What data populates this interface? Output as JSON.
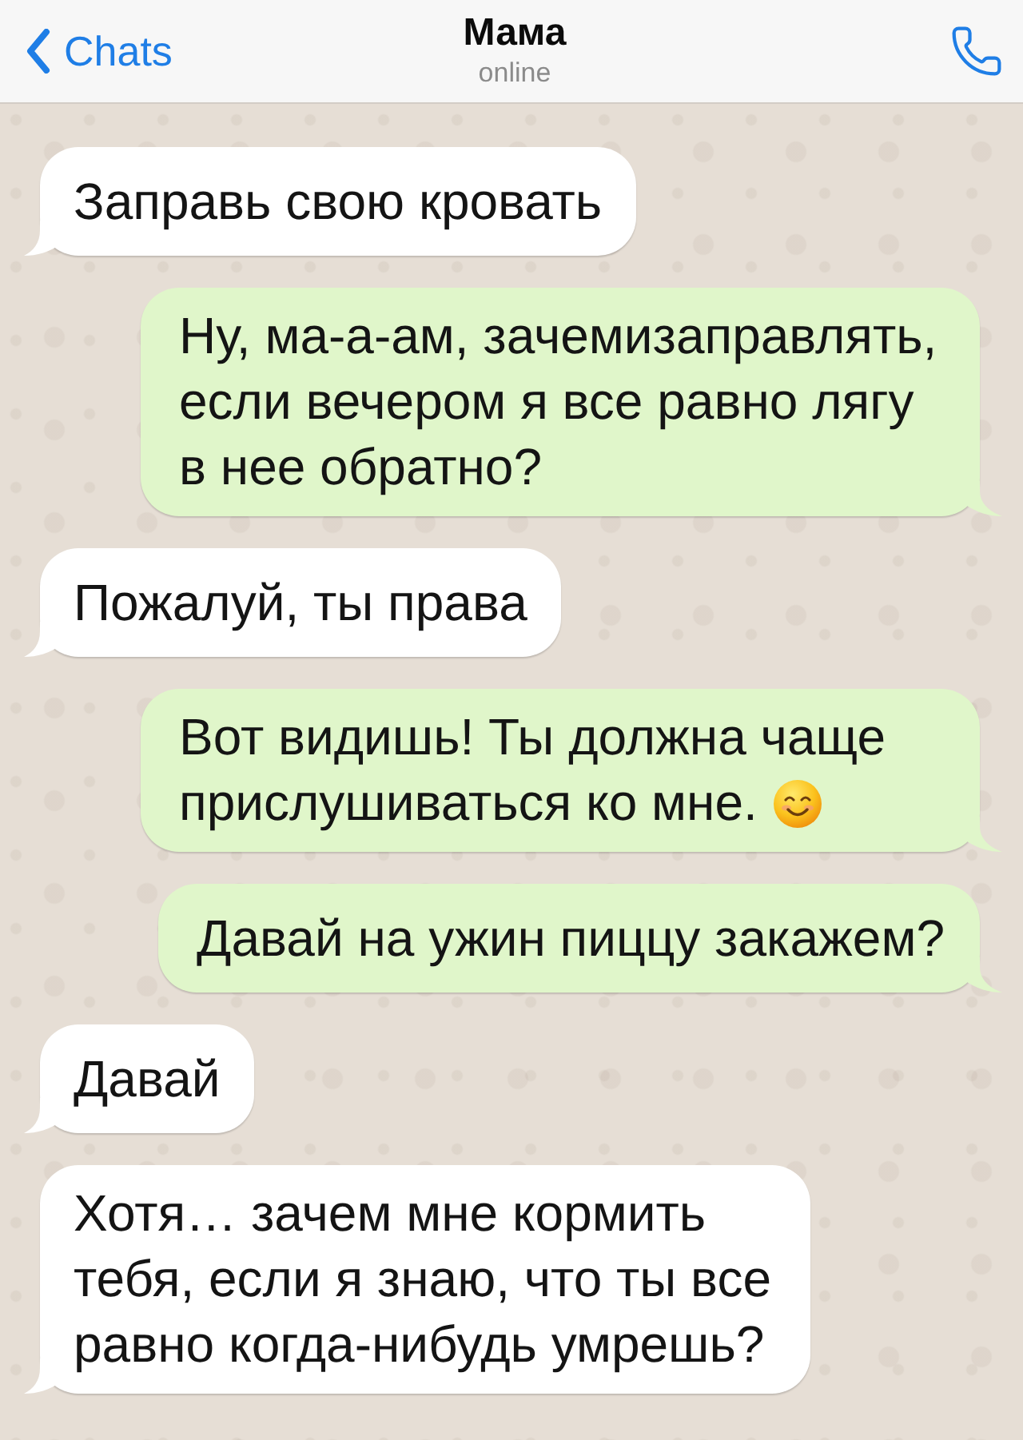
{
  "header": {
    "back_label": "Chats",
    "title": "Мама",
    "status": "online"
  },
  "messages": [
    {
      "kind": "incoming",
      "text": "Заправь свою кровать",
      "emoji": false
    },
    {
      "kind": "outgoing",
      "text": "Ну, ма-а-ам, зачемизаправлять, если вечером я все равно лягу в нее обратно?",
      "emoji": false
    },
    {
      "kind": "incoming",
      "text": "Пожалуй, ты права",
      "emoji": false
    },
    {
      "kind": "outgoing",
      "text": "Вот видишь! Ты должна чаще прислушиваться ко мне.",
      "emoji": true
    },
    {
      "kind": "outgoing",
      "text": "Давай на ужин пиццу закажем?",
      "emoji": false
    },
    {
      "kind": "incoming",
      "text": "Давай",
      "emoji": false
    },
    {
      "kind": "incoming",
      "text": "Хотя… зачем мне кормить тебя, если я знаю, что ты все равно когда-нибудь умрешь?",
      "emoji": false
    }
  ]
}
